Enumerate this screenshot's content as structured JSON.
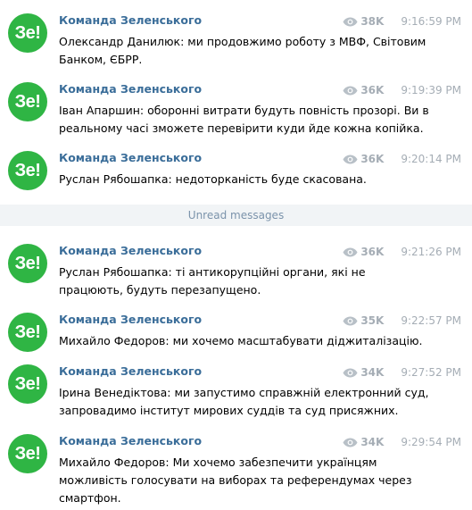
{
  "messages": [
    {
      "avatar": "Зе!",
      "author": "Команда Зеленського",
      "views": "38K",
      "time": "9:16:59 PM",
      "text": "Олександр Данилюк: ми продовжимо роботу з МВФ, Світовим Банком, ЄБРР."
    },
    {
      "avatar": "Зе!",
      "author": "Команда Зеленського",
      "views": "36K",
      "time": "9:19:39 PM",
      "text": "Іван Апаршин: оборонні витрати будуть повність прозорі. Ви в реальному часі зможете перевірити куди йде кожна копійка."
    },
    {
      "avatar": "Зе!",
      "author": "Команда Зеленського",
      "views": "36K",
      "time": "9:20:14 PM",
      "text": "Руслан Рябошапка: недоторканість буде скасована."
    },
    {
      "avatar": "Зе!",
      "author": "Команда Зеленського",
      "views": "36K",
      "time": "9:21:26 PM",
      "text": "Руслан Рябошапка: ті антикорупційні органи, які не працюють, будуть перезапущено."
    },
    {
      "avatar": "Зе!",
      "author": "Команда Зеленського",
      "views": "35K",
      "time": "9:22:57 PM",
      "text": "Михайло Федоров: ми хочемо масштабувати діджиталізацію."
    },
    {
      "avatar": "Зе!",
      "author": "Команда Зеленського",
      "views": "34K",
      "time": "9:27:52 PM",
      "text": "Ірина Венедіктова: ми запустимо справжній електронний суд, запровадимо інститут мирових суддів та суд присяжних."
    },
    {
      "avatar": "Зе!",
      "author": "Команда Зеленського",
      "views": "34K",
      "time": "9:29:54 PM",
      "text": "Михайло Федоров: Ми хочемо забезпечити українцям можливість голосувати на виборах та референдумах через смартфон."
    }
  ],
  "divider": {
    "label": "Unread messages"
  },
  "colors": {
    "avatar_bg": "#2fb544",
    "author": "#3a6d99",
    "meta": "#a5adb5",
    "divider_bg": "#f1f4f6",
    "divider_text": "#7b93ab"
  },
  "icons": {
    "views": "eye-icon"
  }
}
